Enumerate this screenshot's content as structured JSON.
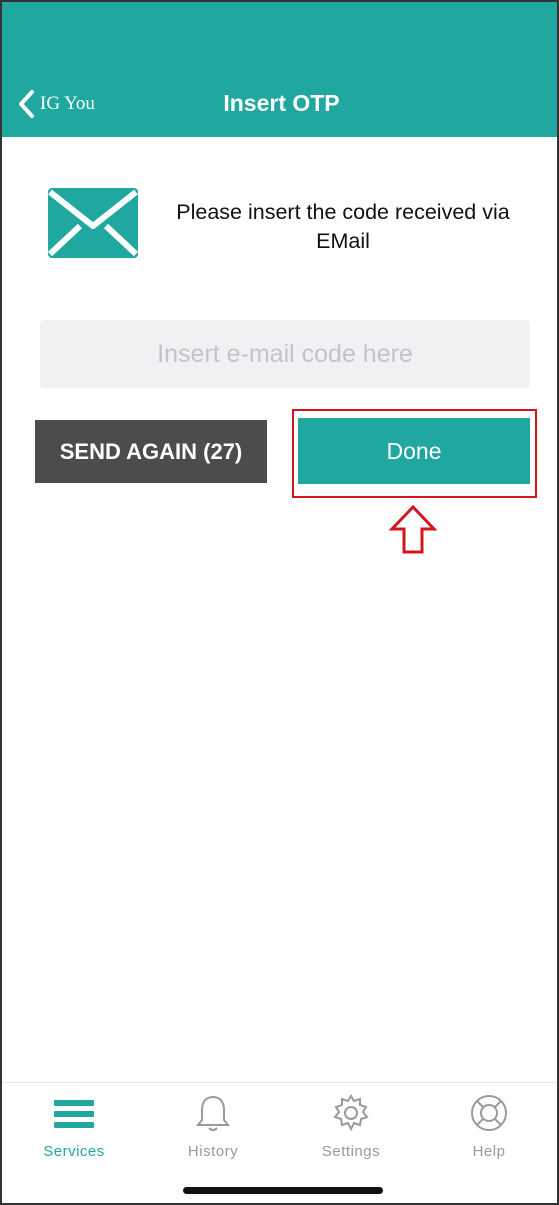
{
  "colors": {
    "accent": "#20a8a0",
    "secondary_button": "#4c4c4c",
    "highlight": "#d4141e"
  },
  "header": {
    "back_label": "IG You",
    "title": "Insert OTP"
  },
  "content": {
    "instruction": "Please insert the code received via EMail",
    "code_input": {
      "placeholder": "Insert e-mail code here",
      "value": ""
    },
    "send_again_label": "SEND AGAIN (27)",
    "done_label": "Done"
  },
  "tabbar": {
    "items": [
      {
        "label": "Services",
        "icon": "menu-icon",
        "active": true
      },
      {
        "label": "History",
        "icon": "bell-icon",
        "active": false
      },
      {
        "label": "Settings",
        "icon": "gear-icon",
        "active": false
      },
      {
        "label": "Help",
        "icon": "lifebuoy-icon",
        "active": false
      }
    ]
  }
}
